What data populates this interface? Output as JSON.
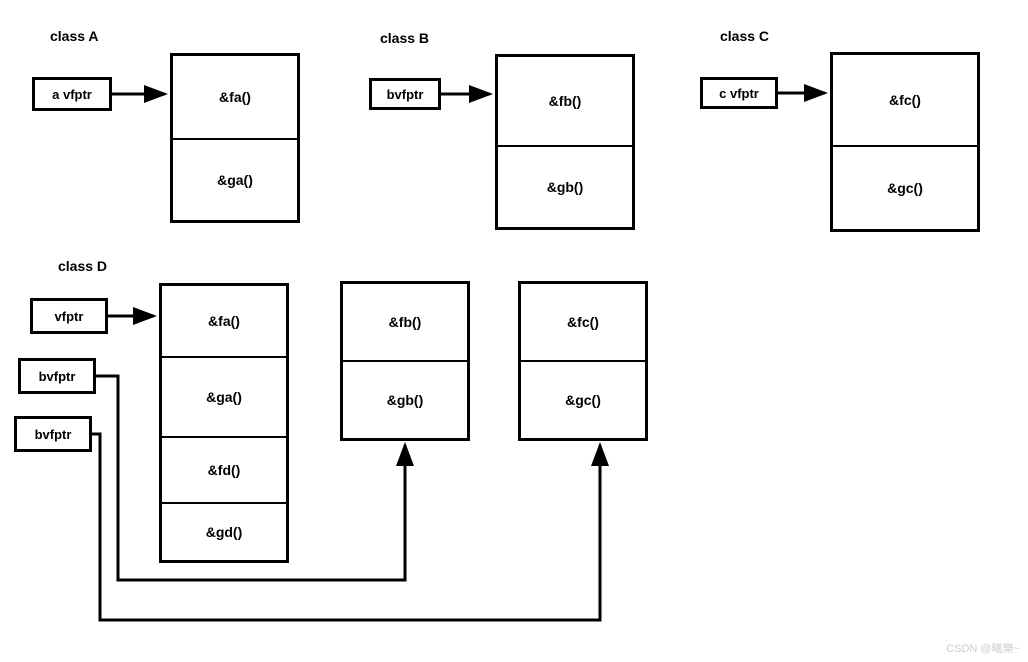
{
  "classes": {
    "a": {
      "title": "class A",
      "ptr": "a vfptr",
      "vtable": [
        "&fa()",
        "&ga()"
      ]
    },
    "b": {
      "title": "class  B",
      "ptr": "bvfptr",
      "vtable": [
        "&fb()",
        "&gb()"
      ]
    },
    "c": {
      "title": "class  C",
      "ptr": "c vfptr",
      "vtable": [
        "&fc()",
        "&gc()"
      ]
    },
    "d": {
      "title": "class  D",
      "ptrs": [
        "vfptr",
        "bvfptr",
        "bvfptr"
      ],
      "vtable1": [
        "&fa()",
        "&ga()",
        "&fd()",
        "&gd()"
      ],
      "vtable2": [
        "&fb()",
        "&gb()"
      ],
      "vtable3": [
        "&fc()",
        "&gc()"
      ]
    }
  },
  "watermark": "CSDN @曦樂~"
}
